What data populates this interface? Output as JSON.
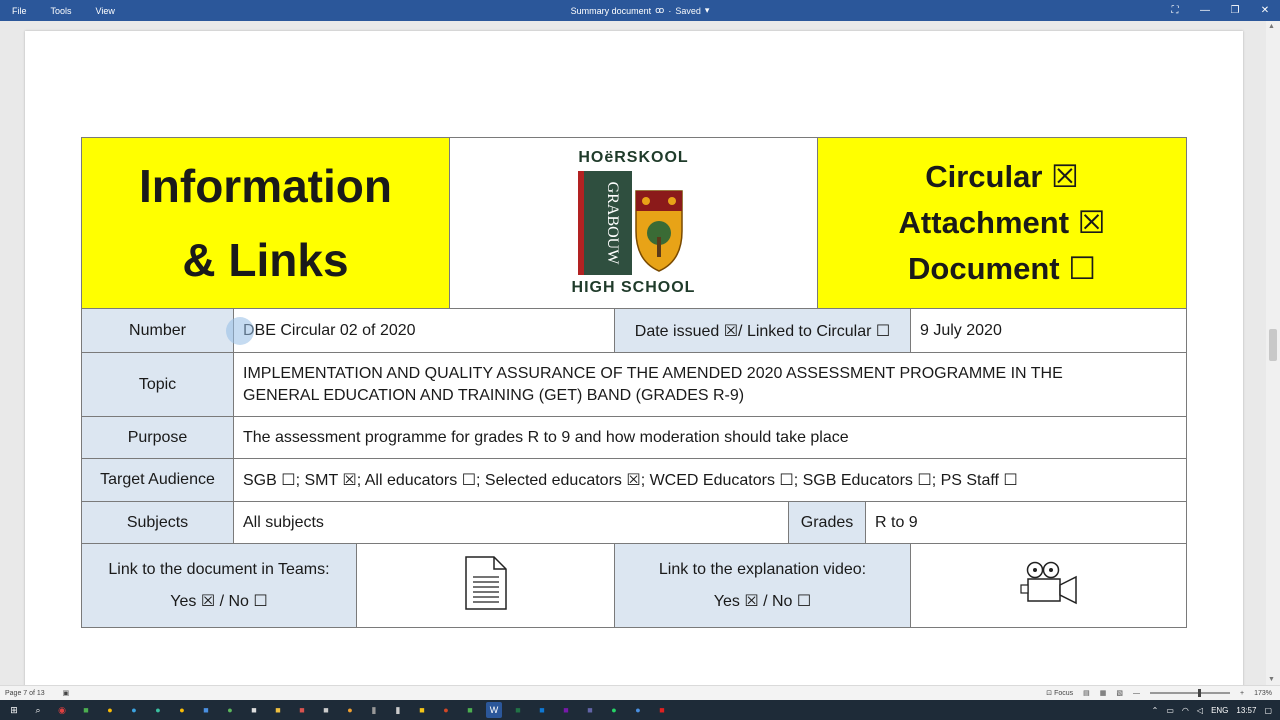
{
  "menu": [
    "File",
    "Tools",
    "View"
  ],
  "doc_title": "Summary document",
  "doc_status": "Saved",
  "window_buttons": [
    "⛶",
    "—",
    "❐",
    "✕"
  ],
  "header": {
    "left_lines": [
      "Information",
      "& Links"
    ],
    "logo_top": "HOëRSKOOL",
    "logo_side": "GRABOUW",
    "logo_bottom": "HIGH SCHOOL",
    "checks": [
      "Circular ☒",
      "Attachment ☒",
      "Document ☐"
    ]
  },
  "rows": {
    "number_label": "Number",
    "number_value": "DBE Circular 02 of 2020",
    "date_label": "Date issued ☒/ Linked to Circular ☐",
    "date_value": "9 July 2020",
    "topic_label": "Topic",
    "topic_value": "IMPLEMENTATION AND QUALITY ASSURANCE OF THE AMENDED 2020 ASSESSMENT PROGRAMME IN THE GENERAL EDUCATION AND TRAINING (GET) BAND (GRADES R-9)",
    "purpose_label": "Purpose",
    "purpose_value": "The assessment programme for grades R to 9 and how moderation should take place",
    "audience_label": "Target Audience",
    "audience_value": "SGB ☐; SMT ☒; All educators ☐; Selected educators ☒; WCED Educators ☐; SGB Educators ☐; PS Staff ☐",
    "subjects_label": "Subjects",
    "subjects_value": "All subjects",
    "grades_label": "Grades",
    "grades_value": "R to 9",
    "teams_link_label": "Link to the document in Teams:",
    "teams_link_choice": "Yes ☒ / No ☐",
    "video_link_label": "Link to the explanation video:",
    "video_link_choice": "Yes ☒ / No ☐"
  },
  "status": {
    "page": "Page 7 of 13",
    "focus": "Focus",
    "zoom": "173%"
  },
  "taskbar": {
    "lang": "ENG",
    "time": "13:57"
  },
  "colors": {
    "titlebar": "#2b579a",
    "label_bg": "#dce6f1",
    "highlight": "#ffff00"
  }
}
